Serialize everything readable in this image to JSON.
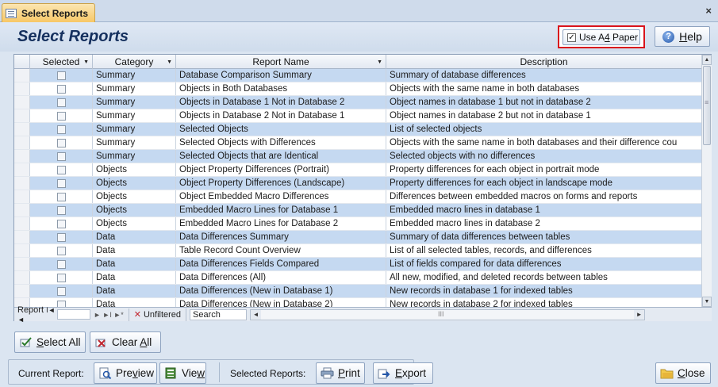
{
  "tab": {
    "label": "Select Reports",
    "close": "×"
  },
  "header": {
    "title": "Select Reports",
    "a4_label": "Use A4 Paper",
    "a4_checked": true,
    "help_label": "Help"
  },
  "grid": {
    "columns": [
      "Selected",
      "Category",
      "Report Name",
      "Description"
    ],
    "rows": [
      {
        "category": "Summary",
        "name": "Database Comparison Summary",
        "description": "Summary of database differences"
      },
      {
        "category": "Summary",
        "name": "Objects in Both Databases",
        "description": "Objects with the same name in both databases"
      },
      {
        "category": "Summary",
        "name": "Objects in Database 1 Not in Database 2",
        "description": "Object names in database 1 but not in database 2"
      },
      {
        "category": "Summary",
        "name": "Objects in Database 2 Not in Database 1",
        "description": "Object names in database 2 but not in database 1"
      },
      {
        "category": "Summary",
        "name": "Selected Objects",
        "description": "List of selected objects"
      },
      {
        "category": "Summary",
        "name": "Selected Objects with Differences",
        "description": "Objects with the same name in both databases and their difference cou"
      },
      {
        "category": "Summary",
        "name": "Selected Objects that are Identical",
        "description": "Selected objects with no differences"
      },
      {
        "category": "Objects",
        "name": "Object Property Differences (Portrait)",
        "description": "Property differences for each object in portrait mode"
      },
      {
        "category": "Objects",
        "name": "Object Property Differences (Landscape)",
        "description": "Property differences for each object in landscape mode"
      },
      {
        "category": "Objects",
        "name": "Object Embedded Macro Differences",
        "description": "Differences between embedded macros on forms and reports"
      },
      {
        "category": "Objects",
        "name": "Embedded Macro Lines for Database 1",
        "description": "Embedded macro lines in database 1"
      },
      {
        "category": "Objects",
        "name": "Embedded Macro Lines for Database 2",
        "description": "Embedded macro lines in database 2"
      },
      {
        "category": "Data",
        "name": "Data Differences Summary",
        "description": "Summary of data differences between tables"
      },
      {
        "category": "Data",
        "name": "Table Record Count Overview",
        "description": "List of all selected tables, records, and differences"
      },
      {
        "category": "Data",
        "name": "Data Differences Fields Compared",
        "description": "List of fields compared for data differences"
      },
      {
        "category": "Data",
        "name": "Data Differences (All)",
        "description": "All new, modified, and deleted records between tables"
      },
      {
        "category": "Data",
        "name": "Data Differences (New in Database 1)",
        "description": "New records in database 1 for indexed tables"
      },
      {
        "category": "Data",
        "name": "Data Differences (New in Database 2)",
        "description": "New records in database 2 for indexed tables"
      }
    ]
  },
  "navbar": {
    "label": "Report",
    "filter": "Unfiltered",
    "search": "Search"
  },
  "buttons": {
    "select_all": "Select All",
    "clear_all": "Clear All",
    "current_report": "Current Report:",
    "preview": "Preview",
    "view": "View",
    "selected_reports": "Selected Reports:",
    "print": "Print",
    "export": "Export",
    "close": "Close"
  },
  "colors": {
    "alt_row": "#c5d9f1",
    "highlight_border": "#d9141c",
    "title": "#15305e"
  }
}
